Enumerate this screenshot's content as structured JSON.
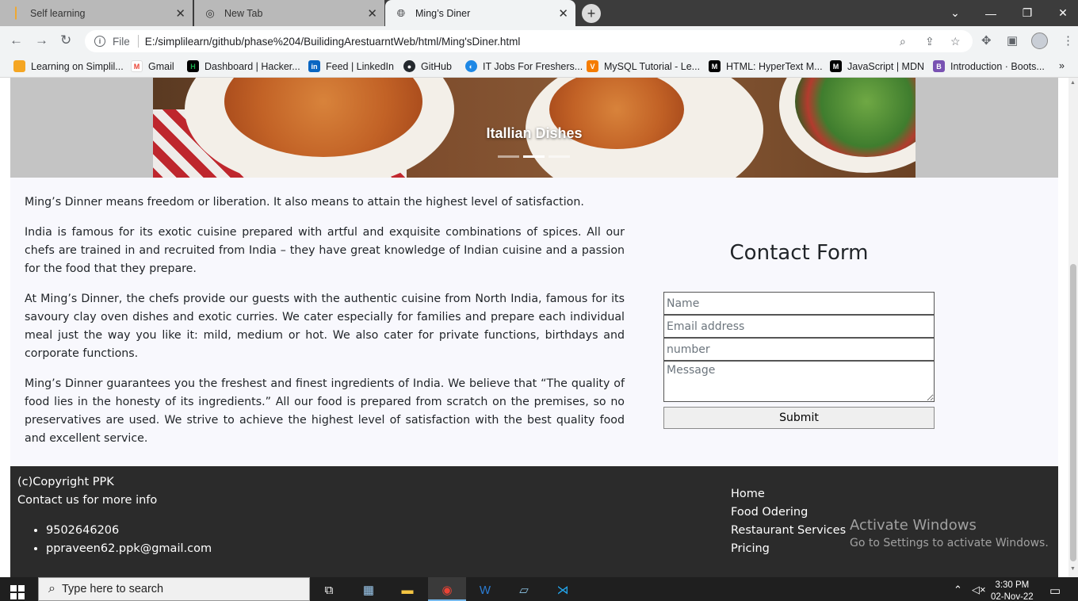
{
  "browser": {
    "tabs": [
      {
        "title": "Self learning",
        "icon": "simplilearn-icon"
      },
      {
        "title": "New Tab",
        "icon": "chrome-icon"
      },
      {
        "title": "Ming’s Diner",
        "icon": "globe-icon"
      }
    ],
    "url_scheme": "File",
    "url": "E:/simplilearn/github/phase%204/BuilidingArestuarntWeb/html/Ming'sDiner.html",
    "bookmarks": [
      {
        "label": "Learning on Simplil...",
        "color": "#f5a623"
      },
      {
        "label": "Gmail",
        "color": "#ea4335"
      },
      {
        "label": "Dashboard | Hacker...",
        "color": "#1ba94c"
      },
      {
        "label": "Feed | LinkedIn",
        "color": "#0a66c2"
      },
      {
        "label": "GitHub",
        "color": "#24292e"
      },
      {
        "label": "IT Jobs For Freshers...",
        "color": "#1e88e5"
      },
      {
        "label": "MySQL Tutorial - Le...",
        "color": "#f57c00"
      },
      {
        "label": "HTML: HyperText M...",
        "color": "#000000"
      },
      {
        "label": "JavaScript | MDN",
        "color": "#000000"
      },
      {
        "label": "Introduction · Boots...",
        "color": "#7952b3"
      }
    ]
  },
  "carousel": {
    "caption": "Itallian Dishes",
    "indicator_count": 3,
    "active_index": 1
  },
  "about": {
    "paragraphs": [
      "Ming’s Dinner means freedom or liberation. It also means to attain the highest level of satisfaction.",
      "India is famous for its exotic cuisine prepared with artful and exquisite combinations of spices. All our chefs are trained in and recruited from India – they have great knowledge of Indian cuisine and a passion for the food that they prepare.",
      "At Ming’s Dinner, the chefs provide our guests with the authentic cuisine from North India, famous for its savoury clay oven dishes and exotic curries. We cater especially for families and prepare each individual meal just the way you like it: mild, medium or hot. We also cater for private functions, birthdays and corporate functions.",
      "Ming’s Dinner guarantees you the freshest and finest ingredients of India. We believe that “The quality of food lies in the honesty of its ingredients.” All our food is prepared from scratch on the premises, so no preservatives are used. We strive to achieve the highest level of satisfaction with the best quality food and excellent service."
    ]
  },
  "contact_form": {
    "title": "Contact Form",
    "name_placeholder": "Name",
    "email_placeholder": "Email address",
    "number_placeholder": "number",
    "message_placeholder": "Message",
    "submit_label": "Submit"
  },
  "footer": {
    "copyright": "(c)Copyright PPK",
    "contact_line": "Contact us for more info",
    "phone": "9502646206",
    "email": "ppraveen62.ppk@gmail.com",
    "links": [
      "Home",
      "Food Odering",
      "Restaurant Services",
      "Pricing"
    ]
  },
  "watermark": {
    "line1": "Activate Windows",
    "line2": "Go to Settings to activate Windows."
  },
  "taskbar": {
    "search_placeholder": "Type here to search",
    "time": "3:30 PM",
    "date": "02-Nov-22"
  }
}
